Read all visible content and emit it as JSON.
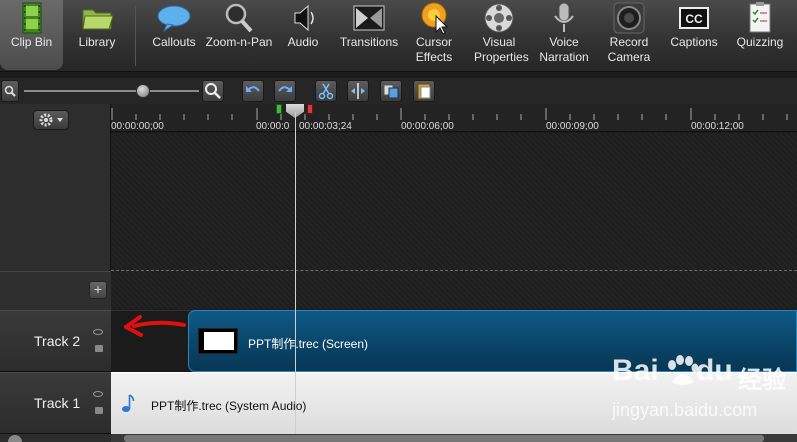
{
  "toolbar": {
    "items": [
      {
        "label": "Clip Bin",
        "icon": "film-strip-icon",
        "active": true
      },
      {
        "label": "Library",
        "icon": "folder-icon"
      },
      {
        "label": "Callouts",
        "icon": "speech-bubble-icon"
      },
      {
        "label": "Zoom-n-Pan",
        "icon": "magnifier-icon"
      },
      {
        "label": "Audio",
        "icon": "speaker-icon"
      },
      {
        "label": "Transitions",
        "icon": "transition-icon"
      },
      {
        "label": "Cursor Effects",
        "icon": "cursor-click-icon"
      },
      {
        "label": "Visual Properties",
        "icon": "film-reel-icon"
      },
      {
        "label": "Voice Narration",
        "icon": "microphone-icon"
      },
      {
        "label": "Record Camera",
        "icon": "webcam-icon"
      },
      {
        "label": "Captions",
        "icon": "cc-icon"
      },
      {
        "label": "Quizzing",
        "icon": "quiz-clipboard-icon"
      }
    ]
  },
  "ruler": {
    "timecodes": [
      "00:00:00;00",
      "00:00:0",
      "00:00:03;24",
      "00:00:06;00",
      "00:00:09;00",
      "00:00:12;00"
    ]
  },
  "tracks": [
    {
      "name": "Track 2",
      "clip": "PPT制作.trec (Screen)"
    },
    {
      "name": "Track 1",
      "clip": "PPT制作.trec (System Audio)"
    }
  ],
  "add_track_symbol": "+",
  "watermark": {
    "brand_a": "Bai",
    "brand_b": "du",
    "cn": "经验",
    "url": "jingyan.baidu.com"
  },
  "colors": {
    "screen_clip": "#0a4569",
    "audio_clip": "#e6e6e6",
    "arrow": "#e01010"
  }
}
